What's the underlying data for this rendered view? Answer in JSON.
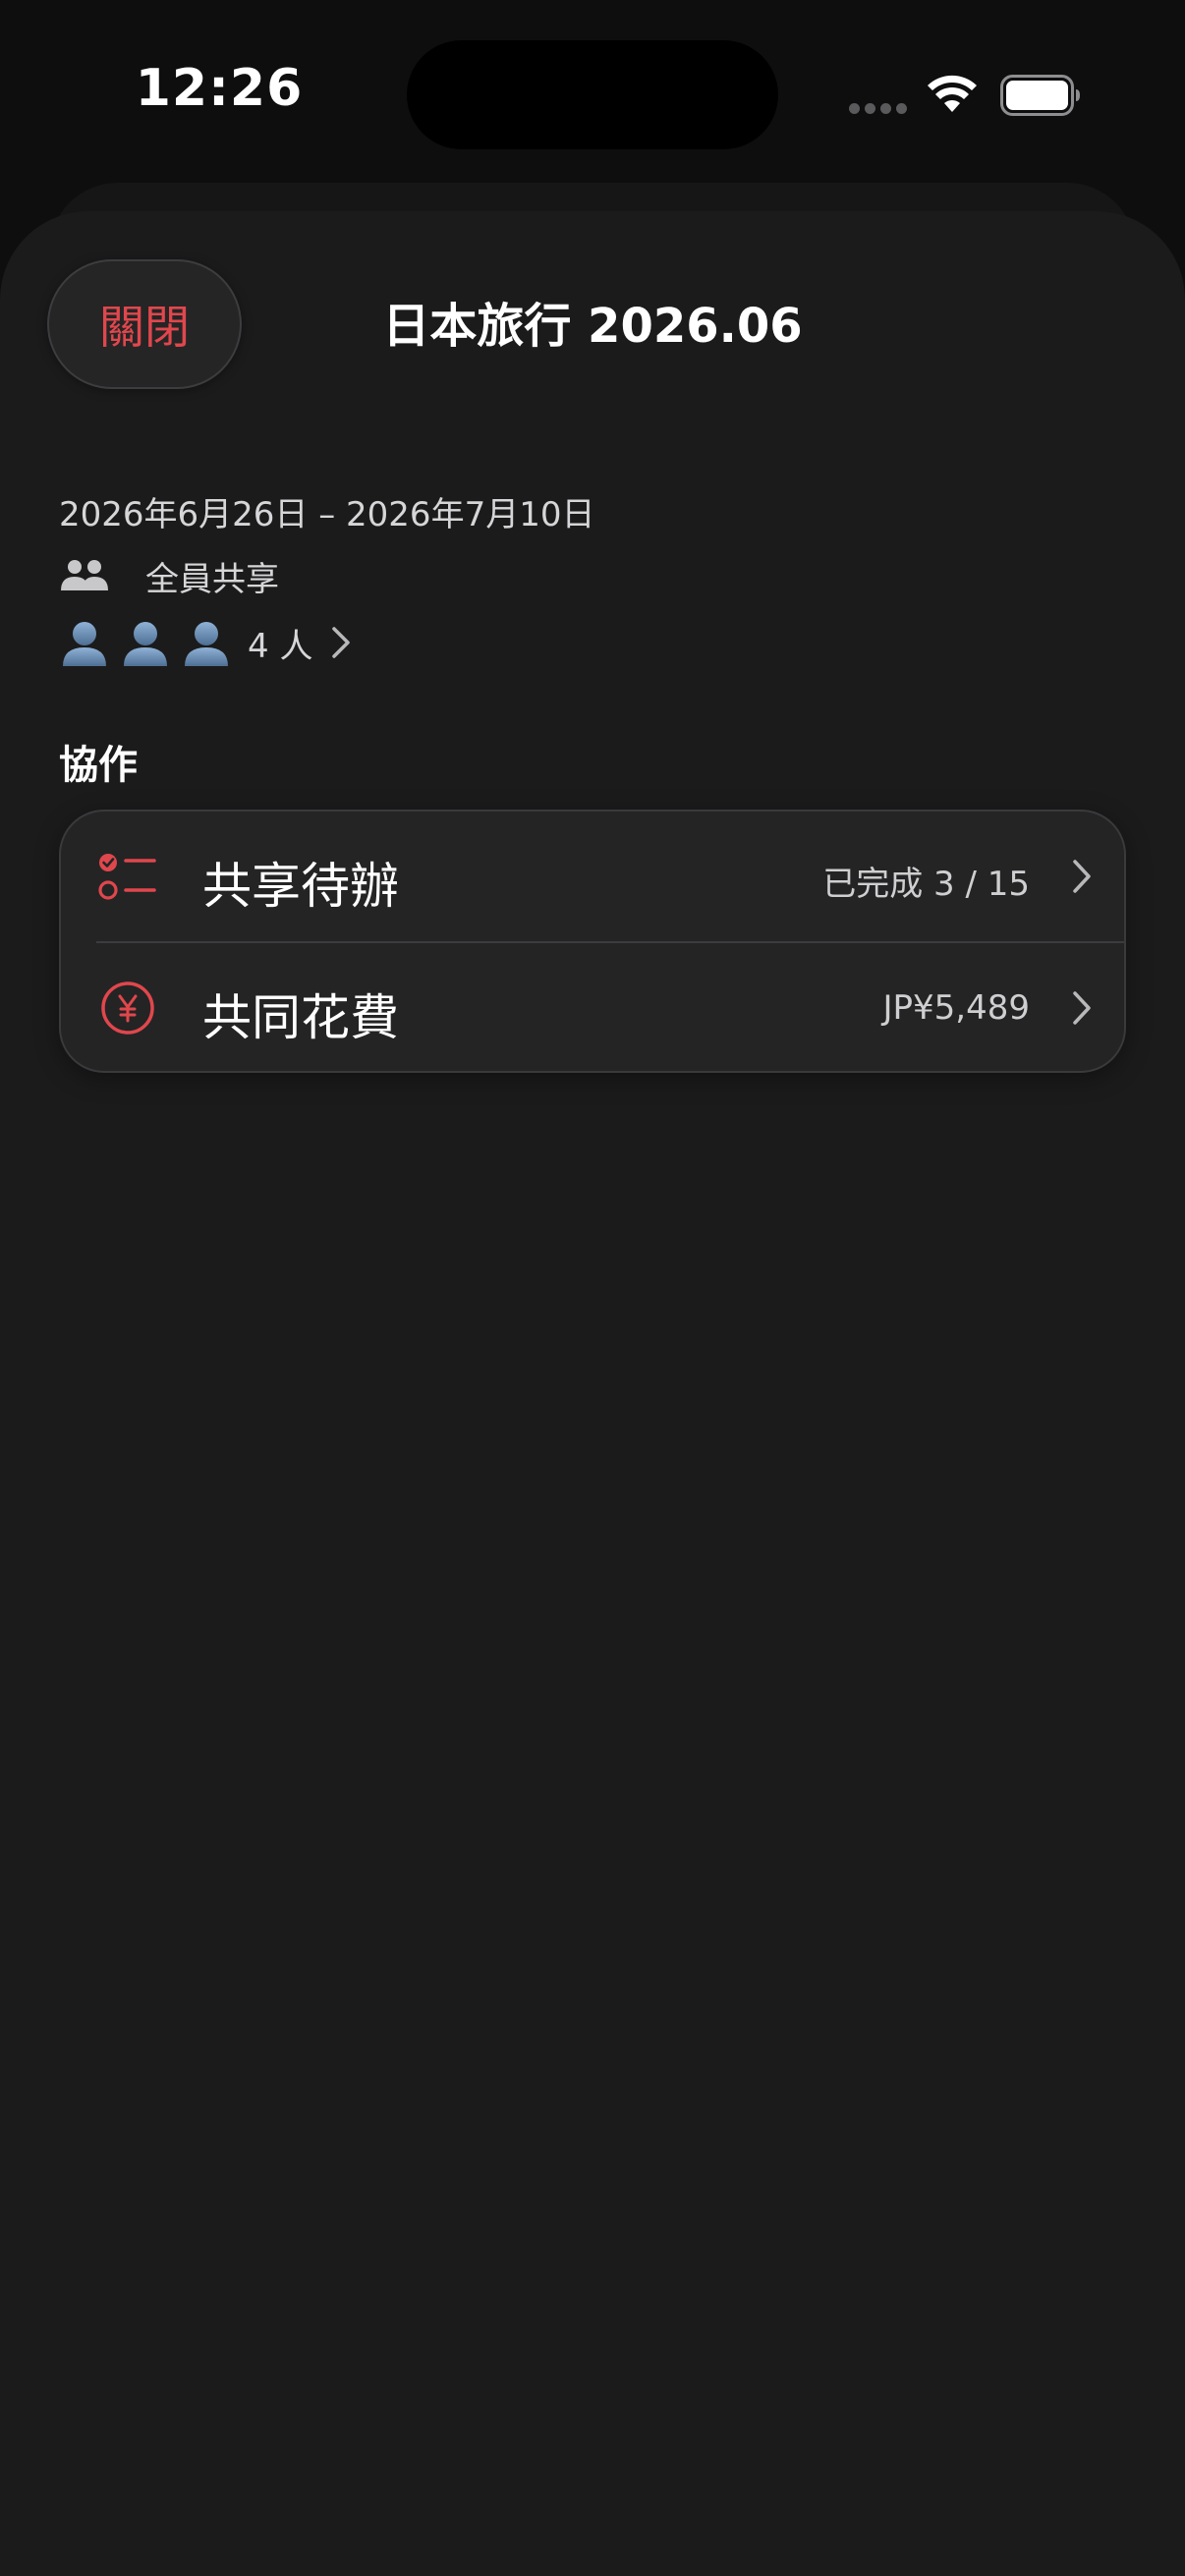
{
  "status_bar": {
    "time": "12:26"
  },
  "nav": {
    "close_label": "關閉",
    "title": "日本旅行 2026.06"
  },
  "trip": {
    "date_range": "2026年6月26日 – 2026年7月10日",
    "share_label": "全員共享",
    "member_count": "4 人"
  },
  "collaboration": {
    "header": "協作",
    "items": [
      {
        "label": "共享待辦",
        "value": "已完成 3 / 15",
        "icon": "checklist-icon"
      },
      {
        "label": "共同花費",
        "value": "JP¥5,489",
        "icon": "yen-circle-icon"
      }
    ]
  },
  "colors": {
    "accent": "#e0474c",
    "background": "#1b1b1c",
    "card": "#242425"
  }
}
